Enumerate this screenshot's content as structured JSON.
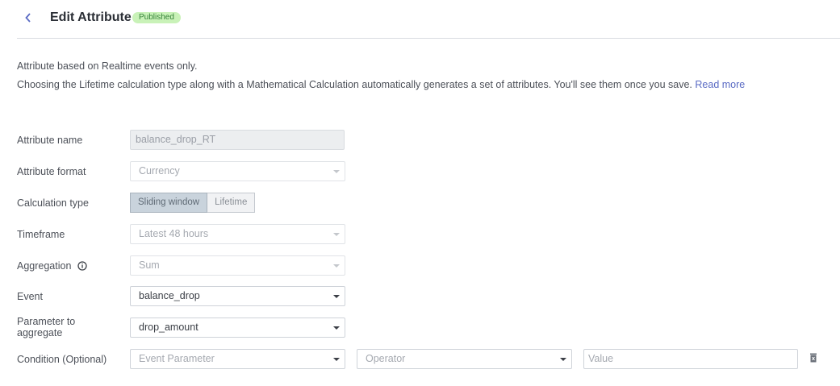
{
  "header": {
    "title": "Edit Attribute",
    "status_badge": "Published"
  },
  "info": {
    "line1": "Attribute based on Realtime events only.",
    "line2": "Choosing the Lifetime calculation type along with a Mathematical Calculation automatically generates a set of attributes. You'll see them once you save.",
    "read_more": "Read more"
  },
  "form": {
    "attribute_name": {
      "label": "Attribute name",
      "value": "balance_drop_RT"
    },
    "attribute_format": {
      "label": "Attribute format",
      "value": "Currency"
    },
    "calculation_type": {
      "label": "Calculation type",
      "options": [
        "Sliding window",
        "Lifetime"
      ],
      "selected": "Sliding window"
    },
    "timeframe": {
      "label": "Timeframe",
      "value": "Latest 48 hours"
    },
    "aggregation": {
      "label": "Aggregation",
      "value": "Sum"
    },
    "event": {
      "label": "Event",
      "value": "balance_drop"
    },
    "parameter": {
      "label": "Parameter to aggregate",
      "value": "drop_amount"
    },
    "condition": {
      "label": "Condition (Optional)",
      "event_parameter_placeholder": "Event Parameter",
      "operator_placeholder": "Operator",
      "value_placeholder": "Value"
    }
  },
  "icons": {
    "back": "chevron-left-icon",
    "aggregation_info": "info-circle-icon",
    "delete_condition": "trash-icon"
  },
  "colors": {
    "accent": "#5a6bc4",
    "badge_bg": "#c9f2b8",
    "badge_text": "#36823a"
  }
}
